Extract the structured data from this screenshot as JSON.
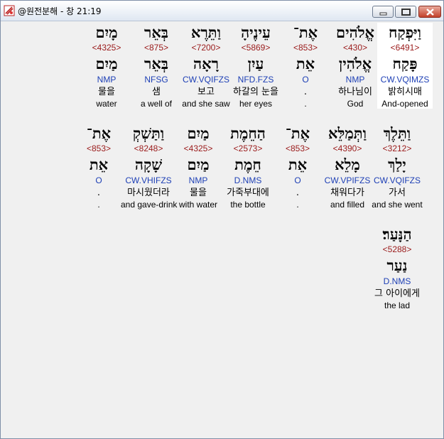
{
  "window": {
    "title": "@원전분해 - 창 21:19"
  },
  "rows": [
    [
      {
        "heb": "וַיִּפְקַח",
        "strong": "<6491>",
        "lemma": "פָּקַח",
        "parse": "CW.VQIMZS",
        "kor": "밝히시매",
        "eng": "And-opened",
        "highlight": true
      },
      {
        "heb": "אֱלֹהִים",
        "strong": "<430>",
        "lemma": "אֱלֹהִין",
        "parse": "NMP",
        "kor": "하나님이",
        "eng": "God"
      },
      {
        "heb": "אֶת־",
        "strong": "<853>",
        "lemma": "אֵת",
        "parse": "O",
        "kor": ".",
        "eng": "."
      },
      {
        "heb": "עֵינֶיהָ",
        "strong": "<5869>",
        "lemma": "עַיִן",
        "parse": "NFD.FZS",
        "kor": "하갈의 눈을",
        "eng": "her eyes"
      },
      {
        "heb": "וַתֵּרֶא",
        "strong": "<7200>",
        "lemma": "רָאָה",
        "parse": "CW.VQIFZS",
        "kor": "보고",
        "eng": "and she saw"
      },
      {
        "heb": "בְּאֵר",
        "strong": "<875>",
        "lemma": "בְּאֵר",
        "parse": "NFSG",
        "kor": "샘",
        "eng": "a well of"
      },
      {
        "heb": "מָיִם",
        "strong": "<4325>",
        "lemma": "מַיִם",
        "parse": "NMP",
        "kor": "물을",
        "eng": "water"
      }
    ],
    [
      {
        "heb": "וַתֵּלֶךְ",
        "strong": "<3212>",
        "lemma": "יָלַךְ",
        "parse": "CW.VQIFZS",
        "kor": "가서",
        "eng": "and she went"
      },
      {
        "heb": "וַתְּמַלֵּא",
        "strong": "<4390>",
        "lemma": "מָלֵא",
        "parse": "CW.VPIFZS",
        "kor": "채워다가",
        "eng": "and filled"
      },
      {
        "heb": "אֶת־",
        "strong": "<853>",
        "lemma": "אֵת",
        "parse": "O",
        "kor": ".",
        "eng": "."
      },
      {
        "heb": "הַחֵמֶת",
        "strong": "<2573>",
        "lemma": "חֵמֶת",
        "parse": "D.NMS",
        "kor": "가죽부대에",
        "eng": "the bottle"
      },
      {
        "heb": "מַיִם",
        "strong": "<4325>",
        "lemma": "מַיִם",
        "parse": "NMP",
        "kor": "물을",
        "eng": "with water"
      },
      {
        "heb": "וַתַּשְׁקְ",
        "strong": "<8248>",
        "lemma": "שָׁקָה",
        "parse": "CW.VHIFZS",
        "kor": "마시웠더라",
        "eng": "and gave-drink"
      },
      {
        "heb": "אֶת־",
        "strong": "<853>",
        "lemma": "אֵת",
        "parse": "O",
        "kor": ".",
        "eng": "."
      }
    ],
    [
      {
        "heb": "הַנָּעַר׃",
        "strong": "<5288>",
        "lemma": "נַעַר",
        "parse": "D.NMS",
        "kor": "그 아이에게",
        "eng": "the lad"
      }
    ]
  ]
}
